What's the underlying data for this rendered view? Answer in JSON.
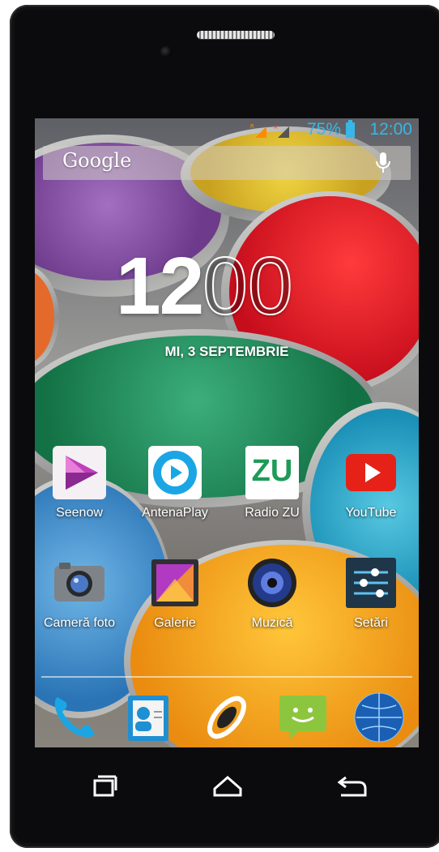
{
  "status_bar": {
    "battery_percent": "75%",
    "time": "12:00",
    "accent_color": "#36b7e6",
    "icons": [
      "signal-sim1-icon",
      "signal-sim2-icon",
      "battery-icon"
    ]
  },
  "search": {
    "logo_text": "Google",
    "icons": [
      "mic-icon"
    ]
  },
  "clock_widget": {
    "hours": "12",
    "minutes": "00",
    "date": "MI, 3 SEPTEMBRIE"
  },
  "apps_row1": [
    {
      "label": "Seenow",
      "icon": "seenow-icon"
    },
    {
      "label": "AntenaPlay",
      "icon": "antenaplay-icon"
    },
    {
      "label": "Radio ZU",
      "icon": "radio-zu-icon",
      "icon_text": "ZU"
    },
    {
      "label": "YouTube",
      "icon": "youtube-icon"
    }
  ],
  "apps_row2": [
    {
      "label": "Cameră foto",
      "icon": "camera-icon"
    },
    {
      "label": "Galerie",
      "icon": "gallery-icon"
    },
    {
      "label": "Muzică",
      "icon": "music-icon"
    },
    {
      "label": "Setări",
      "icon": "settings-icon"
    }
  ],
  "dock": [
    "phone-icon",
    "contacts-icon",
    "launcher-icon",
    "messaging-icon",
    "browser-icon"
  ],
  "navigation": [
    "recent-apps-icon",
    "home-icon",
    "back-icon"
  ]
}
